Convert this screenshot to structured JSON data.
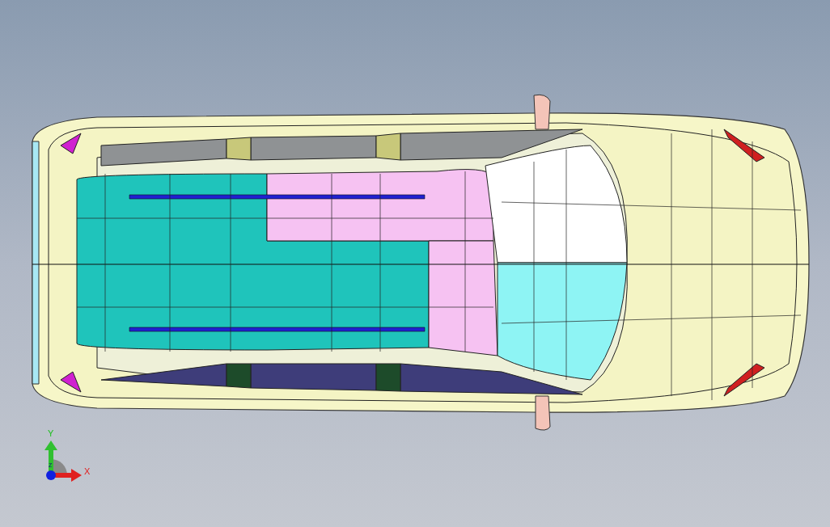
{
  "viewport": {
    "triad": {
      "y_label": "Y",
      "x_label": "X",
      "z_label": "Z"
    }
  }
}
